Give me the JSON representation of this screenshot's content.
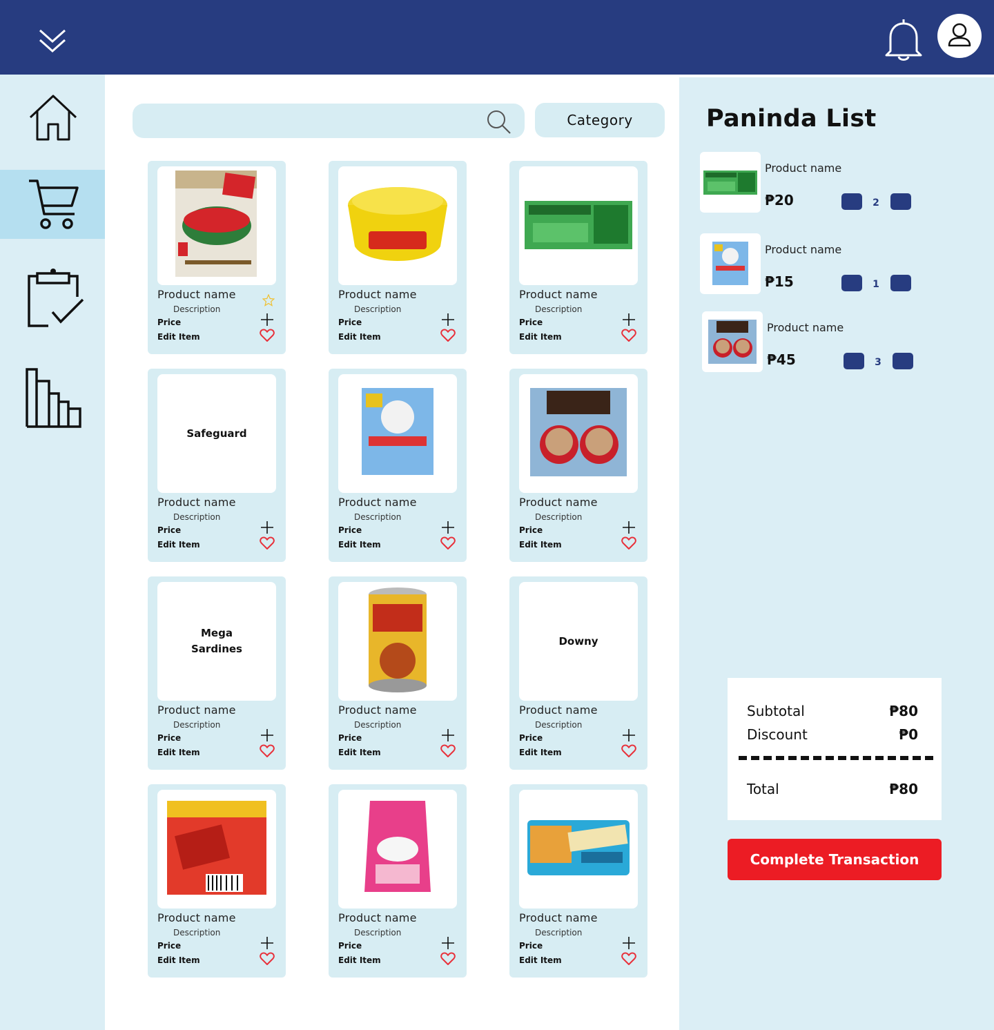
{
  "search": {
    "placeholder": ""
  },
  "category_label": "Category",
  "sidebar": {
    "items": [
      {
        "icon": "home-icon",
        "active": false
      },
      {
        "icon": "cart-icon",
        "active": true
      },
      {
        "icon": "clipboard-check-icon",
        "active": false
      },
      {
        "icon": "bar-chart-icon",
        "active": false
      }
    ]
  },
  "products": [
    {
      "name": "Product name",
      "description": "Description",
      "price_label": "Price",
      "edit_label": "Edit Item",
      "image": "Rebisco Crackers",
      "image_text": "",
      "starred": true
    },
    {
      "name": "Product name",
      "description": "Description",
      "price_label": "Price",
      "edit_label": "Edit Item",
      "image": "Smart dishwashing paste",
      "image_text": "",
      "starred": false
    },
    {
      "name": "Product name",
      "description": "Description",
      "price_label": "Price",
      "edit_label": "Edit Item",
      "image": "Palmolive soap",
      "image_text": "",
      "starred": false
    },
    {
      "name": "Product name",
      "description": "Description",
      "price_label": "Price",
      "edit_label": "Edit Item",
      "image": "",
      "image_text": "Safeguard",
      "starred": false
    },
    {
      "name": "Product name",
      "description": "Description",
      "price_label": "Price",
      "edit_label": "Edit Item",
      "image": "Bear Brand milk pack",
      "image_text": "",
      "starred": false
    },
    {
      "name": "Product name",
      "description": "Description",
      "price_label": "Price",
      "edit_label": "Edit Item",
      "image": "Nescafe Creamy White",
      "image_text": "",
      "starred": false
    },
    {
      "name": "Product name",
      "description": "Description",
      "price_label": "Price",
      "edit_label": "Edit Item",
      "image": "",
      "image_text": "Mega\nSardines",
      "starred": false
    },
    {
      "name": "Product name",
      "description": "Description",
      "price_label": "Price",
      "edit_label": "Edit Item",
      "image": "Wow Ulam Mechado can",
      "image_text": "",
      "starred": false
    },
    {
      "name": "Product name",
      "description": "Description",
      "price_label": "Price",
      "edit_label": "Edit Item",
      "image": "",
      "image_text": "Downy",
      "starred": false
    },
    {
      "name": "Product name",
      "description": "Description",
      "price_label": "Price",
      "edit_label": "Edit Item",
      "image": "Fuego matches",
      "image_text": "",
      "starred": false
    },
    {
      "name": "Product name",
      "description": "Description",
      "price_label": "Price",
      "edit_label": "Edit Item",
      "image": "Surf detergent",
      "image_text": "",
      "starred": false
    },
    {
      "name": "Product name",
      "description": "Description",
      "price_label": "Price",
      "edit_label": "Edit Item",
      "image": "Fudgee Barr",
      "image_text": "",
      "starred": false
    }
  ],
  "panel": {
    "title": "Paninda List",
    "items": [
      {
        "name": "Product name",
        "price": "₱20",
        "qty": "2",
        "image": "Palmolive soap"
      },
      {
        "name": "Product name",
        "price": "₱15",
        "qty": "1",
        "image": "Bear Brand milk pack"
      },
      {
        "name": "Product name",
        "price": "₱45",
        "qty": "3",
        "image": "Nescafe Creamy White"
      }
    ],
    "subtotal_label": "Subtotal",
    "subtotal": "₱80",
    "discount_label": "Discount",
    "discount": "₱0",
    "total_label": "Total",
    "total": "₱80",
    "complete_label": "Complete Transaction"
  },
  "colors": {
    "topbar": "#273c80",
    "panel_bg": "#dbeef5",
    "card_bg": "#d7edf3",
    "accent_red": "#ec1c24",
    "active_nav": "#b5dff0"
  }
}
